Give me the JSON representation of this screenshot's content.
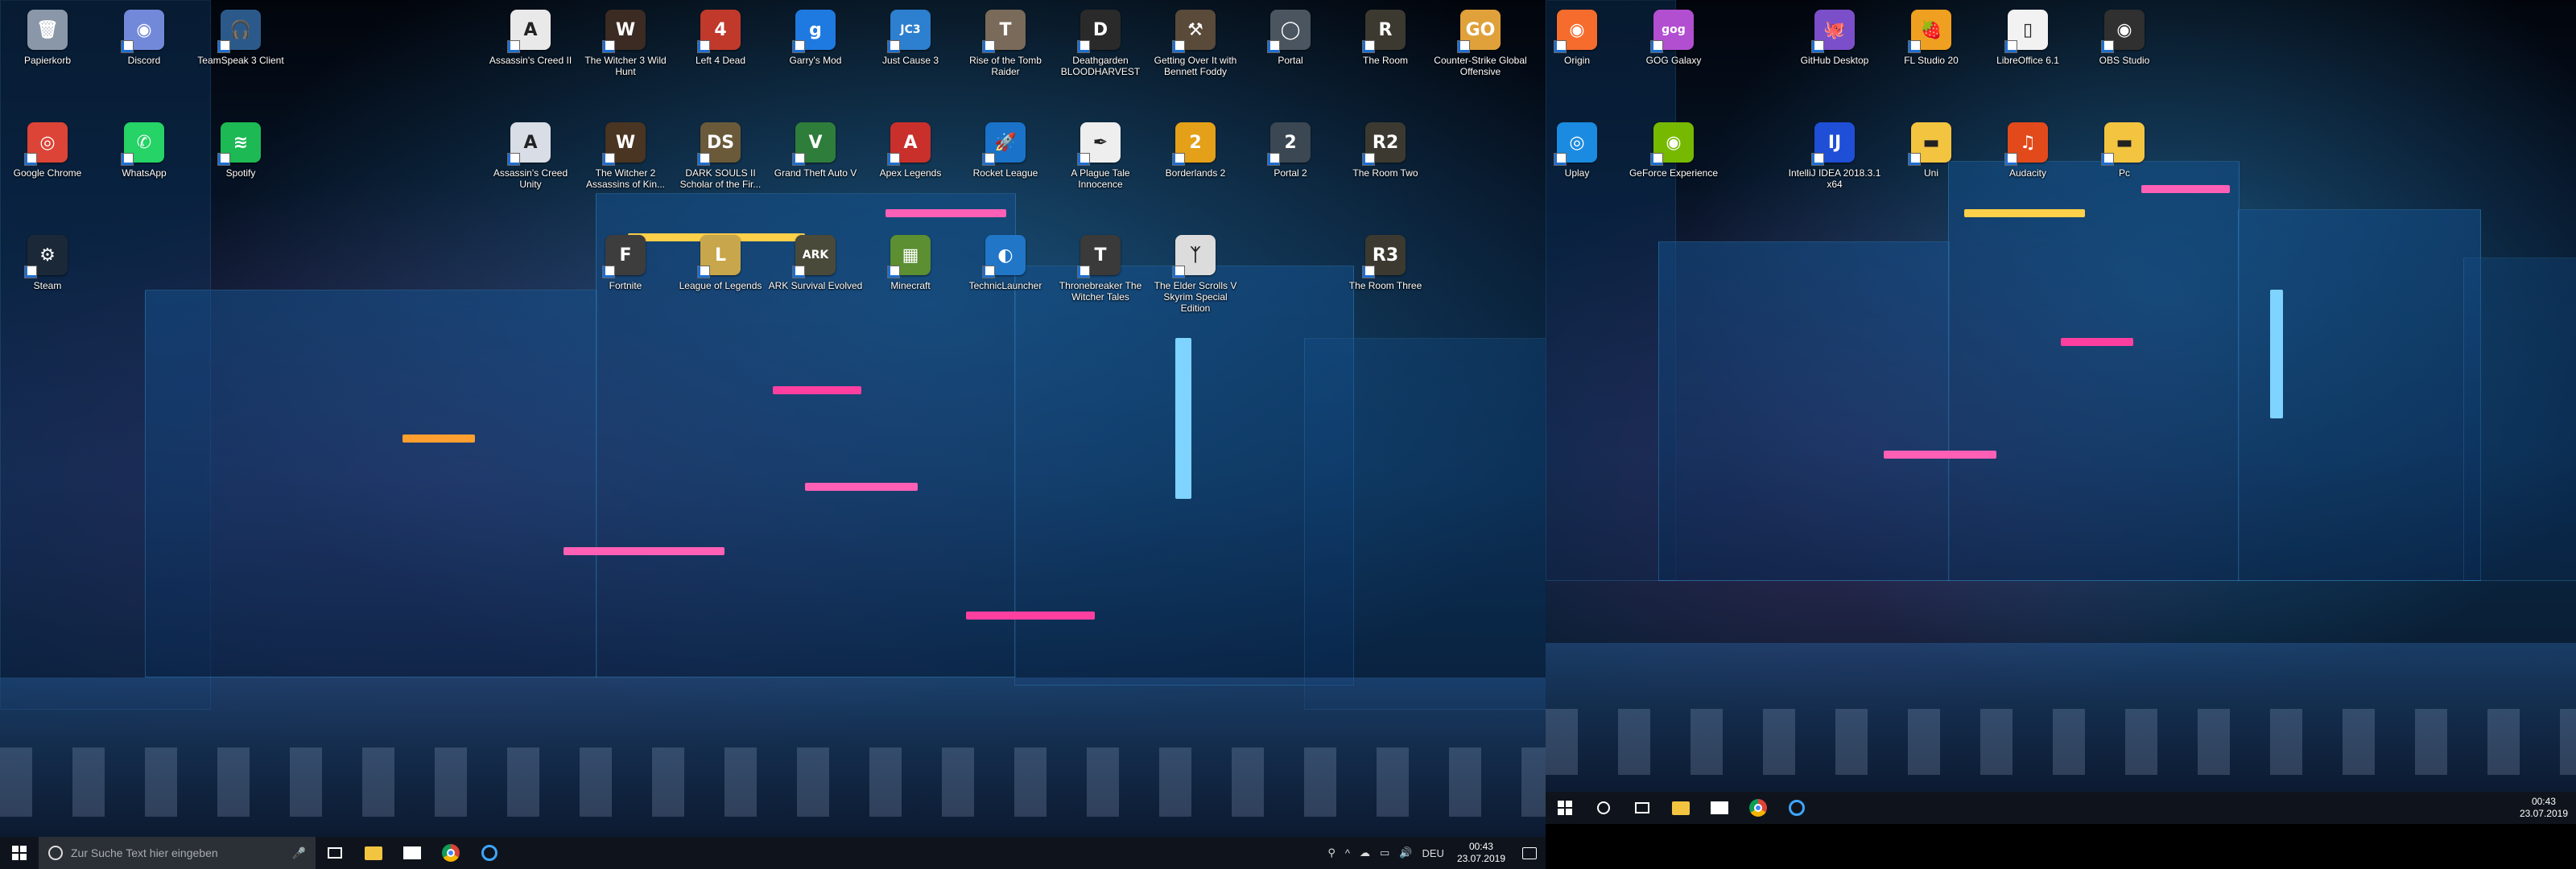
{
  "monitor1": {
    "icons": [
      {
        "label": "Papierkorb",
        "icon": "recycle-bin-icon",
        "color": "#8a97a8",
        "glyph": "🗑"
      },
      {
        "label": "Discord",
        "icon": "discord-icon",
        "color": "#7289da",
        "glyph": "◉"
      },
      {
        "label": "TeamSpeak 3 Client",
        "icon": "teamspeak-icon",
        "color": "#2b5a8a",
        "glyph": "🎧"
      },
      {
        "label": "Google Chrome",
        "icon": "chrome-icon",
        "color": "#db4437",
        "glyph": "◎"
      },
      {
        "label": "WhatsApp",
        "icon": "whatsapp-icon",
        "color": "#25d366",
        "glyph": "✆"
      },
      {
        "label": "Spotify",
        "icon": "spotify-icon",
        "color": "#1db954",
        "glyph": "≋"
      },
      {
        "label": "Steam",
        "icon": "steam-icon",
        "color": "#1b2838",
        "glyph": "⚙"
      },
      {
        "label": "Assassin's Creed II",
        "icon": "assassins-creed-icon",
        "color": "#e9e9e9",
        "glyph": "A"
      },
      {
        "label": "The Witcher 3 Wild Hunt",
        "icon": "witcher-icon",
        "color": "#3b2b22",
        "glyph": "W"
      },
      {
        "label": "Left 4 Dead",
        "icon": "left4dead-icon",
        "color": "#c0392b",
        "glyph": "4"
      },
      {
        "label": "Garry's Mod",
        "icon": "garrys-mod-icon",
        "color": "#1e7ae0",
        "glyph": "g"
      },
      {
        "label": "Just Cause 3",
        "icon": "just-cause-icon",
        "color": "#2d7fcf",
        "glyph": "JC3"
      },
      {
        "label": "Rise of the Tomb Raider",
        "icon": "tomb-raider-icon",
        "color": "#7a6a5a",
        "glyph": "T"
      },
      {
        "label": "Deathgarden BLOODHARVEST",
        "icon": "deathgarden-icon",
        "color": "#2a2a2a",
        "glyph": "D"
      },
      {
        "label": "Getting Over It with Bennett Foddy",
        "icon": "hammer-icon",
        "color": "#5a4a3a",
        "glyph": "⚒"
      },
      {
        "label": "Portal",
        "icon": "portal-icon",
        "color": "#4a5560",
        "glyph": "◯"
      },
      {
        "label": "The Room",
        "icon": "the-room-icon",
        "color": "#3c3a30",
        "glyph": "R"
      },
      {
        "label": "Counter-Strike Global Offensive",
        "icon": "csgo-icon",
        "color": "#e0a13a",
        "glyph": "GO"
      },
      {
        "label": "Origin",
        "icon": "origin-icon",
        "color": "#f56c2d",
        "glyph": "◉"
      },
      {
        "label": "GOG Galaxy",
        "icon": "gog-icon",
        "color": "#b24fd1",
        "glyph": "gog"
      },
      {
        "label": "Assassin's Creed Unity",
        "icon": "assassins-creed-unity-icon",
        "color": "#d8dde6",
        "glyph": "A"
      },
      {
        "label": "The Witcher 2 Assassins of Kin...",
        "icon": "witcher2-icon",
        "color": "#4a3522",
        "glyph": "W"
      },
      {
        "label": "DARK SOULS II Scholar of the Fir...",
        "icon": "dark-souls-icon",
        "color": "#6a5a3a",
        "glyph": "DS"
      },
      {
        "label": "Grand Theft Auto V",
        "icon": "gta-icon",
        "color": "#2f7d3a",
        "glyph": "V"
      },
      {
        "label": "Apex Legends",
        "icon": "apex-icon",
        "color": "#c9302c",
        "glyph": "A"
      },
      {
        "label": "Rocket League",
        "icon": "rocket-league-icon",
        "color": "#1a73c9",
        "glyph": "🚀"
      },
      {
        "label": "A Plague Tale Innocence",
        "icon": "plague-tale-icon",
        "color": "#eee",
        "glyph": "✒"
      },
      {
        "label": "Borderlands 2",
        "icon": "borderlands-icon",
        "color": "#e3a018",
        "glyph": "2"
      },
      {
        "label": "Portal 2",
        "icon": "portal2-icon",
        "color": "#3b4752",
        "glyph": "2"
      },
      {
        "label": "The Room Two",
        "icon": "the-room-two-icon",
        "color": "#3c3a30",
        "glyph": "R2"
      },
      {
        "label": "Fortnite",
        "icon": "fortnite-icon",
        "color": "#3d3d3d",
        "glyph": "F"
      },
      {
        "label": "League of Legends",
        "icon": "league-icon",
        "color": "#c8a64b",
        "glyph": "L"
      },
      {
        "label": "ARK Survival Evolved",
        "icon": "ark-icon",
        "color": "#4a4a3a",
        "glyph": "ARK"
      },
      {
        "label": "Minecraft",
        "icon": "minecraft-icon",
        "color": "#5b8f32",
        "glyph": "▦"
      },
      {
        "label": "TechnicLauncher",
        "icon": "technic-icon",
        "color": "#2176c7",
        "glyph": "◐"
      },
      {
        "label": "Thronebreaker The Witcher Tales",
        "icon": "thronebreaker-icon",
        "color": "#3a3a3a",
        "glyph": "T"
      },
      {
        "label": "The Elder Scrolls V Skyrim Special Edition",
        "icon": "skyrim-icon",
        "color": "#dcdcdc",
        "glyph": "ᛉ"
      },
      {
        "label": "The Room Three",
        "icon": "the-room-three-icon",
        "color": "#3c3a30",
        "glyph": "R3"
      }
    ],
    "taskbar": {
      "search_placeholder": "Zur Suche Text hier eingeben",
      "language": "DEU",
      "time": "00:43",
      "date": "23.07.2019"
    }
  },
  "monitor2": {
    "icons": [
      {
        "label": "GitHub Desktop",
        "icon": "github-desktop-icon",
        "color": "#7a4fc9",
        "glyph": "🐙"
      },
      {
        "label": "FL Studio 20",
        "icon": "fl-studio-icon",
        "color": "#f0a020",
        "glyph": "🍓"
      },
      {
        "label": "LibreOffice 6.1",
        "icon": "libreoffice-icon",
        "color": "#f2f2f2",
        "glyph": "▯"
      },
      {
        "label": "OBS Studio",
        "icon": "obs-icon",
        "color": "#303030",
        "glyph": "◉"
      },
      {
        "label": "Uplay",
        "icon": "uplay-icon",
        "color": "#1a8be0",
        "glyph": "◎"
      },
      {
        "label": "GeForce Experience",
        "icon": "geforce-icon",
        "color": "#76b900",
        "glyph": "◉"
      },
      {
        "label": "IntelliJ IDEA 2018.3.1 x64",
        "icon": "intellij-icon",
        "color": "#1e4fd6",
        "glyph": "IJ"
      },
      {
        "label": "Uni",
        "icon": "folder-icon",
        "color": "#f3c440",
        "glyph": "▬"
      },
      {
        "label": "Audacity",
        "icon": "audacity-icon",
        "color": "#e24a1b",
        "glyph": "♫"
      },
      {
        "label": "Pc",
        "icon": "folder-pc-icon",
        "color": "#f3c440",
        "glyph": "▬"
      }
    ],
    "taskbar": {
      "time": "00:43",
      "date": "23.07.2019"
    }
  },
  "colors": {
    "taskbar_bg": "#10141c",
    "search_bg": "#2b2f36",
    "accent": "#3fa6ff"
  }
}
